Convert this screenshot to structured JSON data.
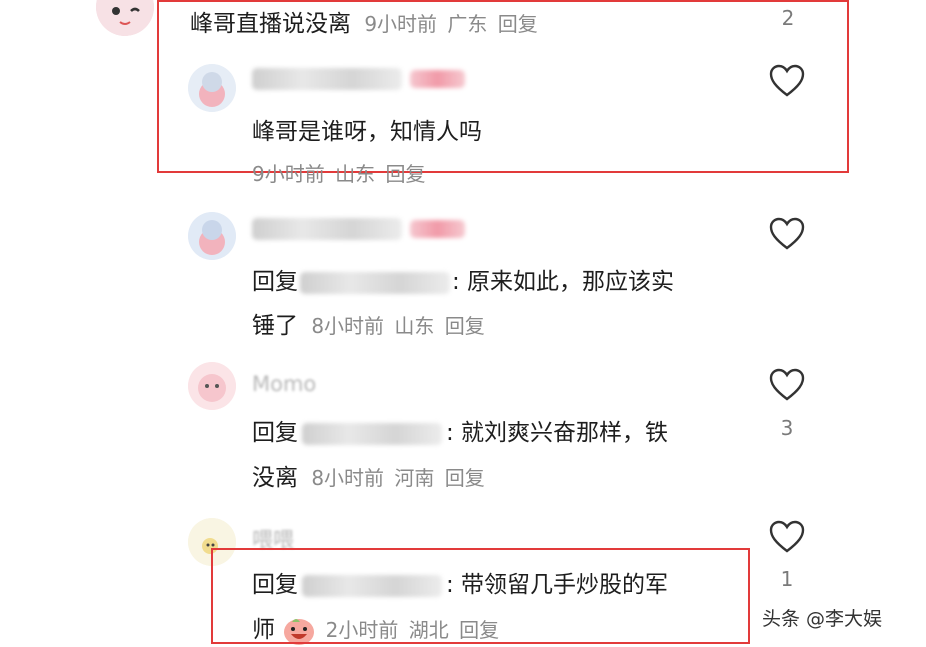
{
  "comments": [
    {
      "body": "峰哥直播说没离",
      "time": "9小时前",
      "location": "广东",
      "reply_label": "回复",
      "like_count": "2"
    },
    {
      "body": "峰哥是谁呀，知情人吗",
      "time": "9小时前",
      "location": "山东",
      "reply_label": "回复"
    },
    {
      "reply_prefix": "回复",
      "body_line1": ": 原来如此，那应该实",
      "body_line2": "锤了",
      "time": "8小时前",
      "location": "山东",
      "reply_label": "回复"
    },
    {
      "username": "Momo",
      "reply_prefix": "回复",
      "body_line1": ": 就刘爽兴奋那样，铁",
      "body_line2": "没离",
      "time": "8小时前",
      "location": "河南",
      "reply_label": "回复",
      "like_count": "3"
    },
    {
      "username": "喂喂",
      "reply_prefix": "回复",
      "body_line1": ": 带领留几手炒股的军",
      "body_line2": "师",
      "time": "2小时前",
      "location": "湖北",
      "reply_label": "回复",
      "like_count": "1"
    }
  ],
  "watermark": "头条 @李大娱",
  "colors": {
    "highlight_border": "#e23a3a",
    "meta_text": "#8a8a8a",
    "body_text": "#1e1e1e"
  },
  "icons": [
    "heart-outline-icon",
    "grinning-emoji-icon"
  ]
}
